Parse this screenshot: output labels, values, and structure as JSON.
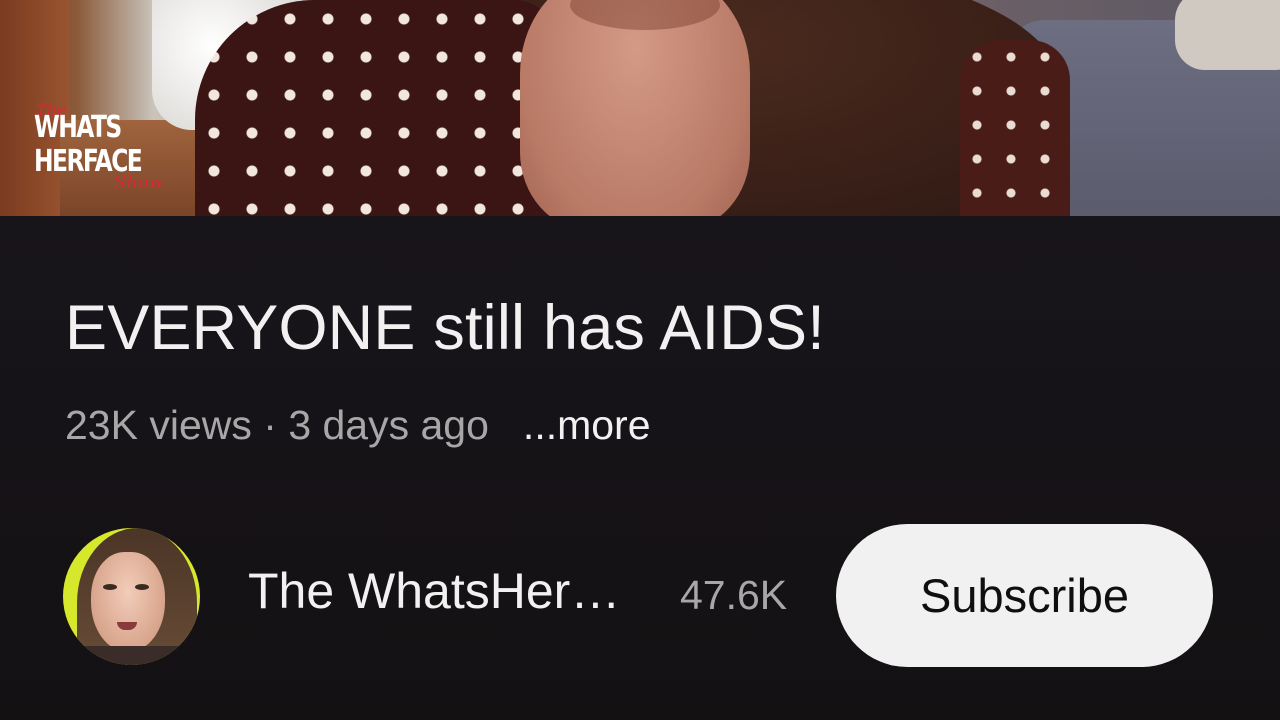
{
  "video": {
    "watermark": {
      "top_script": "The",
      "line1": "WHATS",
      "line2": "HERFACE",
      "bottom_script": "Show"
    }
  },
  "title": "EVERYONE still has AIDS!",
  "meta": {
    "views": "23K views",
    "separator": " · ",
    "age": "3 days ago",
    "more": "...more"
  },
  "channel": {
    "name": "The WhatsHer…",
    "subscribers": "47.6K",
    "subscribe_label": "Subscribe",
    "avatar_bg": "#d6e82c"
  },
  "colors": {
    "background": "#1a1719",
    "title_text": "#f1f1f1",
    "secondary_text": "#a9a6a8",
    "subscribe_bg": "#f1f1f1",
    "subscribe_text": "#0f0f0f",
    "logo_accent": "#d8283a"
  }
}
